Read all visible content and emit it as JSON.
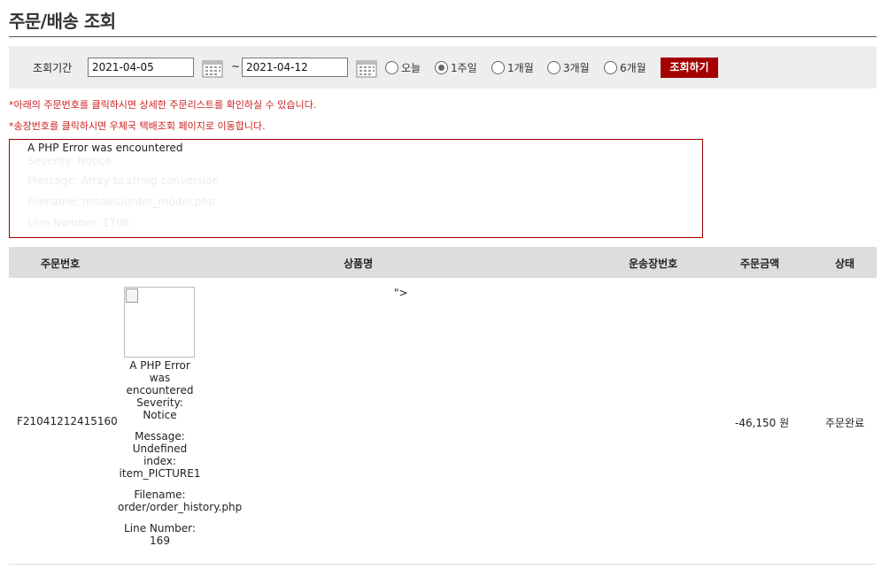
{
  "page": {
    "title": "주문/배송 조회"
  },
  "search": {
    "period_label": "조회기간",
    "start_date": "2021-04-05",
    "end_date": "2021-04-12",
    "separator": "~",
    "ranges": [
      {
        "label": "오늘",
        "selected": false
      },
      {
        "label": "1주일",
        "selected": true
      },
      {
        "label": "1개월",
        "selected": false
      },
      {
        "label": "3개월",
        "selected": false
      },
      {
        "label": "6개월",
        "selected": false
      }
    ],
    "submit_label": "조회하기"
  },
  "notices": [
    "*아래의 주문번호를 클릭하시면 상세한 주문리스트를 확인하실 수 있습니다.",
    "*송장번호를 클릭하시면 우체국 택배조회 페이지로 이동합니다."
  ],
  "error_box": {
    "heading": "A PHP Error was encountered",
    "faint_lines": [
      "Severity: Notice",
      "Message: Array to string conversion",
      "Filename: models/order_model.php",
      "Line Number: 1706"
    ]
  },
  "table": {
    "headers": [
      "주문번호",
      "상품명",
      "운송장번호",
      "주문금액",
      "상태"
    ],
    "rows": [
      {
        "order_no": "F21041212415160",
        "product_stray": "\">",
        "php_error": {
          "heading": [
            "A PHP Error",
            "was",
            "encountered",
            "Severity:",
            "Notice"
          ],
          "message": [
            "Message:",
            "Undefined",
            "index:",
            "item_PICTURE1"
          ],
          "filename": [
            "Filename:",
            "order/order_history.php"
          ],
          "line": [
            "Line Number:",
            "169"
          ]
        },
        "tracking_no": "",
        "amount": "-46,150 원",
        "status": "주문완료"
      }
    ]
  },
  "colors": {
    "accent": "#a50000",
    "notice": "#cc2222",
    "header_bg": "#dddddd",
    "search_bg": "#eeeeee"
  },
  "icons": [
    "calendar-icon",
    "calendar-icon",
    "broken-image-icon"
  ]
}
